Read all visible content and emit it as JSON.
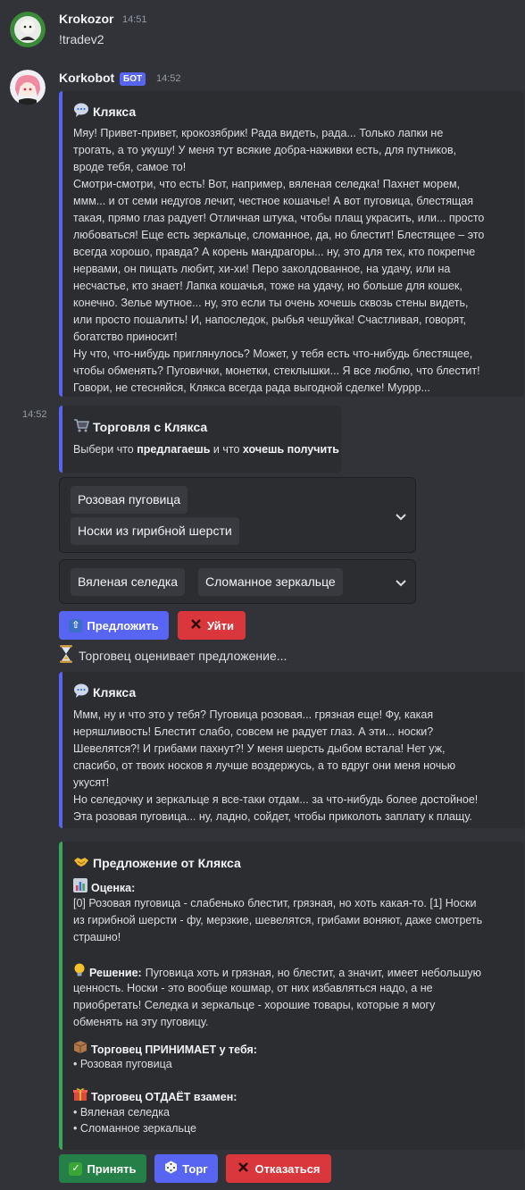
{
  "messages": [
    {
      "author": "Krokozor",
      "time": "14:51",
      "text": "!tradev2"
    },
    {
      "author": "Korkobot",
      "badge": "БОТ",
      "time": "14:52"
    }
  ],
  "embed1": {
    "title": "Клякса",
    "icon": "speech-bubble-icon",
    "description": "Мяу! Привет-привет, крокозябрик! Рада видеть, рада... Только лапки не\nтрогать, а то укушу! У меня тут всякие добра-наживки есть, для путников,\nвроде тебя, самое то!\nСмотри-смотри, что есть! Вот, например, вяленая селедка! Пахнет морем,\nммм... и от семи недугов лечит, честное кошачье! А вот пуговица, блестящая\nтакая, прямо глаз радует! Отличная штука, чтобы плащ украсить, или... просто\nлюбоваться! Еще есть зеркальце, сломанное, да, но блестит! Блестящее – это\nвсегда хорошо, правда? А корень мандрагоры... ну, это для тех, кто покрепче\nнервами, он пищать любит, хи-хи! Перо заколдованное, на удачу, или на\nнесчастье, кто знает! Лапка кошачья, тоже на удачу, но больше для кошек,\nконечно. Зелье мутное... ну, это если ты очень хочешь сквозь стены видеть,\nили просто пошалить! И, напоследок, рыбья чешуйка! Счастливая, говорят,\nбогатство приносит!\nНу что, что-нибудь приглянулось? Может, у тебя есть что-нибудь блестящее,\nчтобы обменять? Пуговички, монетки, стеклышки... Я все люблю, что блестит!\nГовори, не стесняйся, Клякса всегда рада выгодной сделке! Муррр..."
  },
  "followup_time": "14:52",
  "embed2": {
    "title": "Торговля с Клякса",
    "icon": "cart-icon",
    "desc_pre": "Выбери что ",
    "desc_b1": "предлагаешь",
    "desc_mid": " и что ",
    "desc_b2": "хочешь получить"
  },
  "select1": {
    "chips": [
      "Розовая пуговица",
      "Носки из гирибной шерсти"
    ]
  },
  "select2": {
    "chips": [
      "Вяленая селедка",
      "Сломанное зеркальце"
    ]
  },
  "buttons1": {
    "offer": "Предложить",
    "offer_icon": "outbox-tray-icon",
    "leave": "Уйти",
    "leave_icon": "cross-icon"
  },
  "status_line": {
    "icon": "hourglass-icon",
    "text": "Торговец оценивает предложение..."
  },
  "embed3": {
    "title": "Клякса",
    "icon": "speech-bubble-icon",
    "description": "Ммм, ну и что это у тебя? Пуговица розовая... грязная еще! Фу, какая\nнеряшливость! Блестит слабо, совсем не радует глаз. А эти... носки?\nШевелятся?! И грибами пахнут?! У меня шерсть дыбом встала! Нет уж,\nспасибо, от твоих носков я лучше воздержусь, а то вдруг они меня ночью\nукусят!\nНо селедочку и зеркальце я все-таки отдам... за что-нибудь более достойное!\nЭта розовая пуговица... ну, ладно, сойдет, чтобы приколоть заплату к плащу."
  },
  "embed4": {
    "title": "Предложение от Клякса",
    "icon": "handshake-icon",
    "rating_label": "Оценка:",
    "rating_icon": "bar-chart-icon",
    "rating_lines": [
      "[0] Розовая пуговица - слабенько блестит, грязная, но хоть какая-то. [1] Носки",
      "из гирибной шерсти - фу, мерзкие, шевелятся, грибами воняют, даже смотреть",
      "страшно!"
    ],
    "decision_label": "Решение:",
    "decision_icon": "light-bulb-icon",
    "decision_first": " Пуговица хоть и грязная, но блестит, а значит, имеет небольшую",
    "decision_lines": [
      "ценность. Носки - это вообще кошмар, от них избавляться надо, а не",
      "приобретать! Селедка и зеркальце - хорошие товары, которые я могу",
      "обменять на эту пуговицу."
    ],
    "accepts_label": "Торговец ПРИНИМАЕТ у тебя:",
    "accepts_icon": "package-icon",
    "accepts_items": [
      "• Розовая пуговица"
    ],
    "gives_label": "Торговец ОТДАЁТ взамен:",
    "gives_icon": "gift-icon",
    "gives_items": [
      "• Вяленая селедка",
      "• Сломанное зеркальце"
    ]
  },
  "buttons2": {
    "accept": "Принять",
    "accept_icon": "check-mark-icon",
    "haggle": "Торг",
    "haggle_icon": "dice-icon",
    "decline": "Отказаться",
    "decline_icon": "cross-icon"
  },
  "colors": {
    "background": "#323339",
    "embed_bg": "#2b2d31",
    "blurple": "#5865f2",
    "green": "#248046",
    "red": "#da373c",
    "embed_green_border": "#3ba55c"
  }
}
